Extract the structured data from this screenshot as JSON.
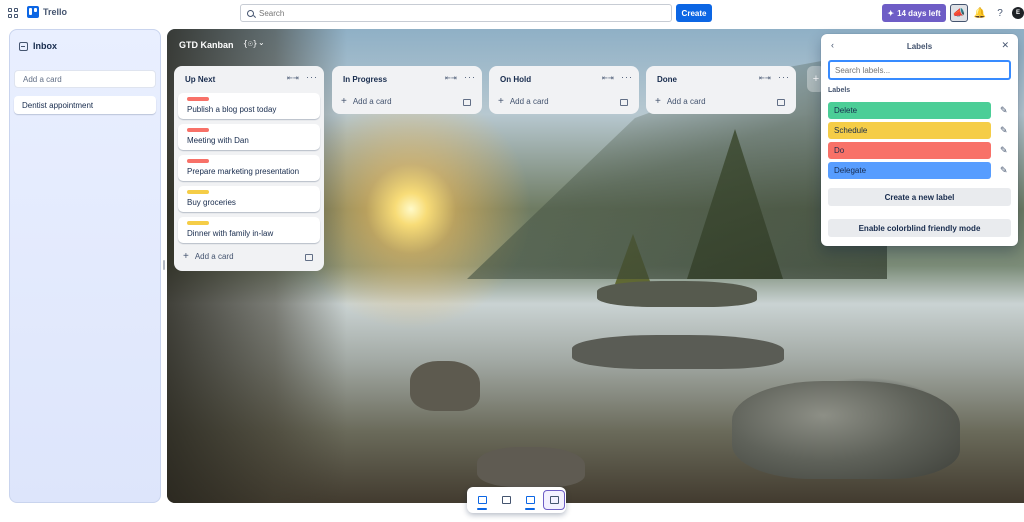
{
  "topbar": {
    "app_name": "Trello",
    "search_placeholder": "Search",
    "create_label": "Create",
    "trial_label": "14 days left",
    "trial_icon": "sparkle-icon",
    "avatar_initial": "E"
  },
  "inbox": {
    "title": "Inbox",
    "add_card_placeholder": "Add a card",
    "cards": [
      "Dentist appointment"
    ]
  },
  "board": {
    "title": "GTD Kanban",
    "visibility_glyph": "{☉}",
    "lists": [
      {
        "title": "Up Next",
        "cards": [
          {
            "text": "Publish a blog post today",
            "label_color": "#f87168"
          },
          {
            "text": "Meeting with Dan",
            "label_color": "#f87168"
          },
          {
            "text": "Prepare marketing presentation",
            "label_color": "#f87168"
          },
          {
            "text": "Buy groceries",
            "label_color": "#f5cd47"
          },
          {
            "text": "Dinner with family in-law",
            "label_color": "#f5cd47"
          }
        ],
        "add_card_label": "Add a card"
      },
      {
        "title": "In Progress",
        "cards": [],
        "add_card_label": "Add a card"
      },
      {
        "title": "On Hold",
        "cards": [],
        "add_card_label": "Add a card"
      },
      {
        "title": "Done",
        "cards": [],
        "add_card_label": "Add a card"
      }
    ]
  },
  "labels_popover": {
    "title": "Labels",
    "search_placeholder": "Search labels...",
    "section_title": "Labels",
    "labels": [
      {
        "name": "Delete",
        "color": "#4bce97"
      },
      {
        "name": "Schedule",
        "color": "#f5cd47"
      },
      {
        "name": "Do",
        "color": "#f87168"
      },
      {
        "name": "Delegate",
        "color": "#579dff"
      }
    ],
    "create_label": "Create a new label",
    "colorblind_label": "Enable colorblind friendly mode"
  },
  "view_switcher": {
    "items": [
      "inbox-view-icon",
      "calendar-view-icon",
      "board-view-icon",
      "switch-boards-icon"
    ]
  }
}
